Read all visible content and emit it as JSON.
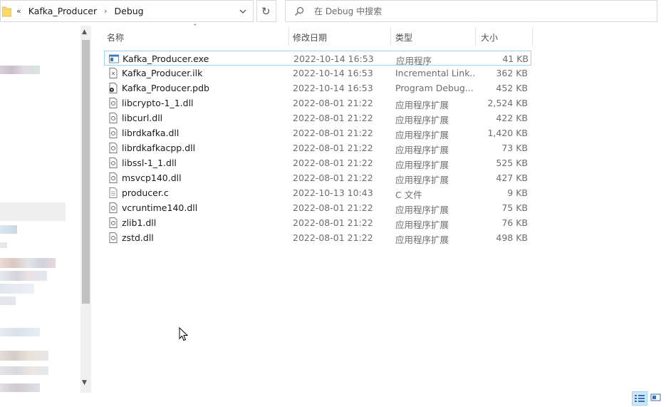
{
  "address_bar": {
    "overflow": "«",
    "crumbs": [
      "Kafka_Producer",
      "Debug"
    ],
    "separator": "›"
  },
  "refresh": {
    "icon": "refresh-icon"
  },
  "search": {
    "placeholder": "在 Debug 中搜索"
  },
  "columns": {
    "name": "名称",
    "date": "修改日期",
    "type": "类型",
    "size": "大小"
  },
  "files": [
    {
      "name": "Kafka_Producer.exe",
      "date": "2022-10-14 16:53",
      "type": "应用程序",
      "size": "41 KB",
      "icon": "exe-file-icon",
      "selected": true
    },
    {
      "name": "Kafka_Producer.ilk",
      "date": "2022-10-14 16:53",
      "type": "Incremental Link...",
      "size": "362 KB",
      "icon": "generic-file-icon"
    },
    {
      "name": "Kafka_Producer.pdb",
      "date": "2022-10-14 16:53",
      "type": "Program Debug...",
      "size": "452 KB",
      "icon": "pdb-file-icon"
    },
    {
      "name": "libcrypto-1_1.dll",
      "date": "2022-08-01 21:22",
      "type": "应用程序扩展",
      "size": "2,524 KB",
      "icon": "dll-file-icon"
    },
    {
      "name": "libcurl.dll",
      "date": "2022-08-01 21:22",
      "type": "应用程序扩展",
      "size": "422 KB",
      "icon": "dll-file-icon"
    },
    {
      "name": "librdkafka.dll",
      "date": "2022-08-01 21:22",
      "type": "应用程序扩展",
      "size": "1,420 KB",
      "icon": "dll-file-icon"
    },
    {
      "name": "librdkafkacpp.dll",
      "date": "2022-08-01 21:22",
      "type": "应用程序扩展",
      "size": "73 KB",
      "icon": "dll-file-icon"
    },
    {
      "name": "libssl-1_1.dll",
      "date": "2022-08-01 21:22",
      "type": "应用程序扩展",
      "size": "525 KB",
      "icon": "dll-file-icon"
    },
    {
      "name": "msvcp140.dll",
      "date": "2022-08-01 21:22",
      "type": "应用程序扩展",
      "size": "427 KB",
      "icon": "dll-file-icon"
    },
    {
      "name": "producer.c",
      "date": "2022-10-13 10:43",
      "type": "C 文件",
      "size": "9 KB",
      "icon": "text-file-icon"
    },
    {
      "name": "vcruntime140.dll",
      "date": "2022-08-01 21:22",
      "type": "应用程序扩展",
      "size": "75 KB",
      "icon": "dll-file-icon"
    },
    {
      "name": "zlib1.dll",
      "date": "2022-08-01 21:22",
      "type": "应用程序扩展",
      "size": "76 KB",
      "icon": "dll-file-icon"
    },
    {
      "name": "zstd.dll",
      "date": "2022-08-01 21:22",
      "type": "应用程序扩展",
      "size": "498 KB",
      "icon": "dll-file-icon"
    }
  ],
  "colors": {
    "selection_border": "#99d1ff",
    "selection_fill": "#cce8ff",
    "folder_yellow": "#ffd766"
  }
}
